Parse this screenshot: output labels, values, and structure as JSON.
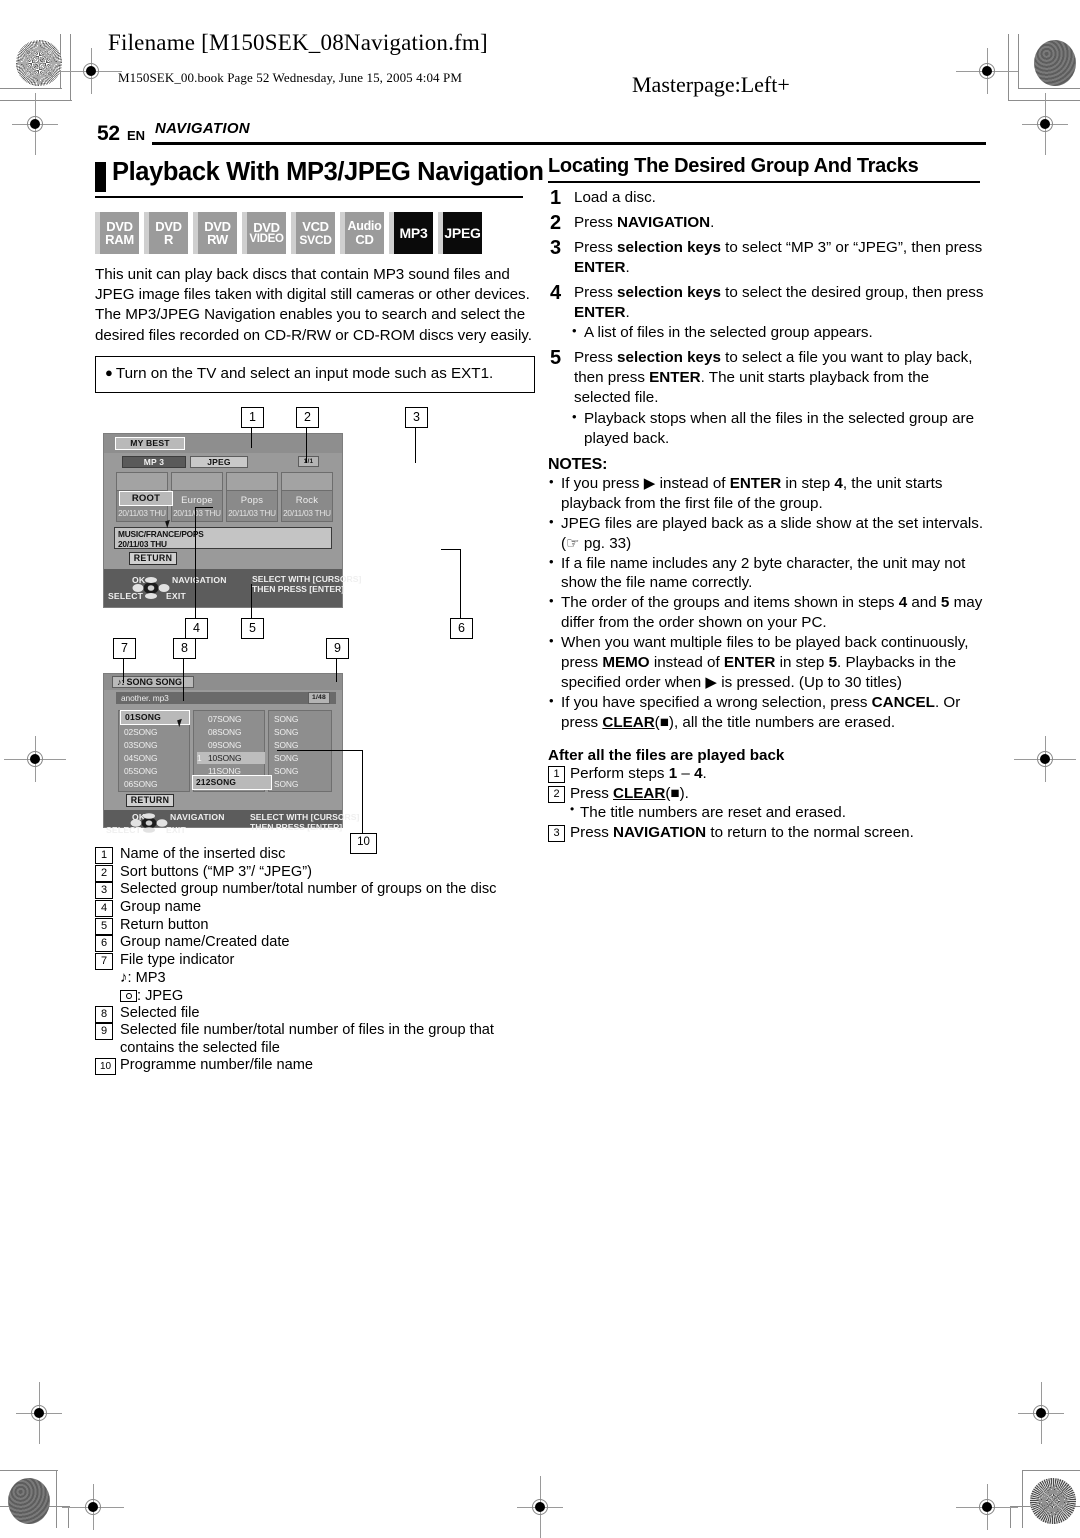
{
  "header": {
    "filename": "Filename [M150SEK_08Navigation.fm]",
    "bookline": "M150SEK_00.book  Page 52  Wednesday, June 15, 2005  4:04 PM",
    "masterpage": "Masterpage:Left+"
  },
  "runninghead": {
    "page_number": "52",
    "lang": "EN",
    "chapter": "NAVIGATION"
  },
  "left": {
    "title": "Playback With MP3/JPEG Navigation",
    "disc_badges": [
      {
        "line1": "DVD",
        "line2": "RAM",
        "state": "gray"
      },
      {
        "line1": "DVD",
        "line2": "R",
        "state": "gray"
      },
      {
        "line1": "DVD",
        "line2": "RW",
        "state": "gray"
      },
      {
        "line1": "DVD",
        "line2": "VIDEO",
        "state": "gray"
      },
      {
        "line1": "VCD",
        "line2": "SVCD",
        "state": "gray"
      },
      {
        "line1": "Audio",
        "line2": "CD",
        "state": "gray"
      },
      {
        "line1": "MP3",
        "line2": "",
        "state": "black"
      },
      {
        "line1": "JPEG",
        "line2": "",
        "state": "black"
      }
    ],
    "intro": "This unit can play back discs that contain MP3 sound files and JPEG image files taken with digital still cameras or other devices. The MP3/JPEG Navigation enables you to search and select the desired files recorded on CD-R/RW or CD-ROM discs very easily.",
    "note_box": "Turn on the TV and select an input mode such as EXT1."
  },
  "screen1": {
    "callouts": [
      "1",
      "2",
      "3",
      "4",
      "5",
      "6"
    ],
    "disc_name": "MY BEST",
    "sort_tabs": [
      {
        "label": "MP 3",
        "selected": true
      },
      {
        "label": "JPEG",
        "selected": false
      }
    ],
    "group_counter": "1/1",
    "groups": [
      {
        "name": "ROOT",
        "date": "20/11/03 THU",
        "selected": true
      },
      {
        "name": "Europe",
        "date": "20/11/03 THU",
        "selected": false
      },
      {
        "name": "Pops",
        "date": "20/11/03 THU",
        "selected": false
      },
      {
        "name": "Rock",
        "date": "20/11/03 THU",
        "selected": false
      }
    ],
    "path_line1": "MUSIC/FRANCE/POPS",
    "path_line2": "20/11/03 THU",
    "return_label": "RETURN",
    "help": {
      "ok": "OK",
      "select": "SELECT",
      "navigation": "NAVIGATION",
      "exit": "EXIT",
      "hint_line1": "SELECT WITH [CURSORS]",
      "hint_line2": "THEN PRESS [ENTER]"
    }
  },
  "screen2": {
    "callouts": [
      "7",
      "8",
      "9",
      "10"
    ],
    "type_icon": "music-note-icon",
    "group_title": "SONG SONG",
    "file_name": "another. mp3",
    "file_counter": "1/48",
    "column1": [
      "01SONG",
      "02SONG",
      "03SONG",
      "04SONG",
      "05SONG",
      "06SONG"
    ],
    "column2": [
      {
        "prog": "",
        "name": "07SONG"
      },
      {
        "prog": "",
        "name": "08SONG"
      },
      {
        "prog": "",
        "name": "09SONG"
      },
      {
        "prog": "1",
        "name": "10SONG"
      },
      {
        "prog": "",
        "name": "11SONG"
      },
      {
        "prog": "2",
        "name": "12SONG"
      }
    ],
    "column3": [
      "SONG",
      "SONG",
      "SONG",
      "SONG",
      "SONG",
      "SONG"
    ],
    "selected_file": "01SONG",
    "return_label": "RETURN",
    "help": {
      "ok": "OK",
      "select": "SELECT",
      "navigation": "NAVIGATION",
      "exit": "EXIT",
      "hint_line1": "SELECT WITH [CURSORS]",
      "hint_line2": "THEN PRESS [ENTER]"
    }
  },
  "legend": [
    {
      "num": "1",
      "text": "Name of the inserted disc"
    },
    {
      "num": "2",
      "text": "Sort buttons (“MP 3”/ “JPEG”)"
    },
    {
      "num": "3",
      "text": "Selected group number/total number of groups on the disc"
    },
    {
      "num": "4",
      "text": "Group name"
    },
    {
      "num": "5",
      "text": "Return button"
    },
    {
      "num": "6",
      "text": "Group name/Created date"
    },
    {
      "num": "7",
      "text": "File type indicator"
    },
    {
      "num": "8",
      "text": "Selected file"
    },
    {
      "num": "9",
      "text": "Selected file number/total number of files in the group that contains the selected file"
    },
    {
      "num": "10",
      "text": "Programme number/file name"
    }
  ],
  "legend_sub": {
    "mp3": ": MP3",
    "jpeg": ": JPEG"
  },
  "right": {
    "heading": "Locating The Desired Group And Tracks",
    "steps": [
      {
        "num": "1",
        "html": "Load a disc."
      },
      {
        "num": "2",
        "html": "Press <b>NAVIGATION</b>."
      },
      {
        "num": "3",
        "html": "Press <b>selection keys</b> to select “MP 3” or “JPEG”, then press <b>ENTER</b>."
      },
      {
        "num": "4",
        "html": "Press <b>selection keys</b> to select the desired group, then press <b>ENTER</b>."
      },
      {
        "num": "5",
        "html": "Press <b>selection keys</b> to select a file you want to play back, then press <b>ENTER</b>. The unit starts playback from the selected file."
      }
    ],
    "step4_sub": "A list of files in the selected group appears.",
    "step5_sub": "Playback stops when all the files in the selected group are played back.",
    "notes_heading": "NOTES:",
    "notes": [
      "If you press ▶ instead of <b>ENTER</b> in step <b>4</b>, the unit starts playback from the first file of the group.",
      "JPEG files are played back as a slide show at the set intervals. (☞ pg. 33)",
      "If a file name includes any 2 byte character, the unit may not show the file name correctly.",
      "The order of the groups and items shown in steps <b>4</b> and <b>5</b> may differ from the order shown on your PC.",
      "When you want multiple files to be played back continuously, press <b>MEMO</b> instead of <b>ENTER</b> in step <b>5</b>. Playbacks in the specified order when ▶ is pressed. (Up to 30 titles)",
      "If you have specified a wrong selection, press <b>CANCEL</b>. Or press <span class=\"ul\">CLEAR</span>(■), all the title numbers are erased."
    ],
    "after_heading": "After all the files are played back",
    "after_steps": [
      {
        "num": "1",
        "html": "Perform steps <b>1</b> – <b>4</b>."
      },
      {
        "num": "2",
        "html": "Press <span class=\"ul\">CLEAR</span>(■)."
      },
      {
        "num": "3",
        "html": "Press <b>NAVIGATION</b> to return to the normal screen."
      }
    ],
    "after_sub": "The title numbers are reset and erased."
  }
}
